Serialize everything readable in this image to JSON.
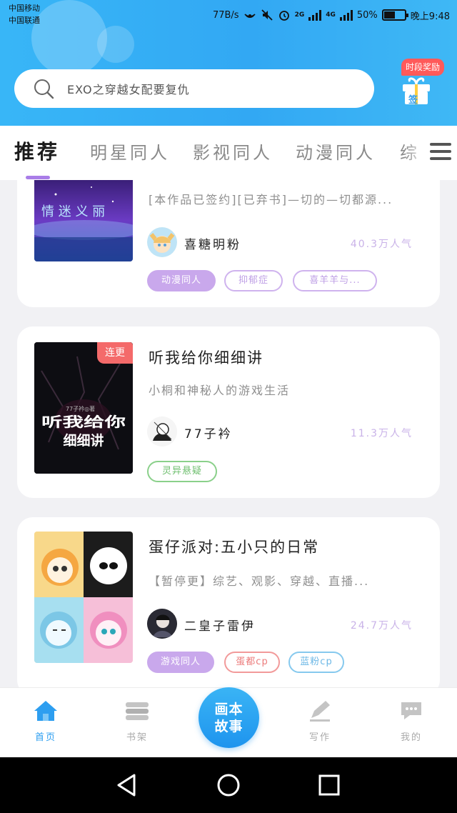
{
  "status_bar": {
    "carrier1": "中国移动",
    "carrier2": "中国联通",
    "speed": "77B/s",
    "network1": "2G",
    "network2": "4G",
    "battery": "50%",
    "battery_level": 0.5,
    "time": "晚上9:48"
  },
  "search": {
    "placeholder": "EXO之穿越女配要复仇",
    "icon": "search-icon"
  },
  "reward": {
    "tag": "时段奖励",
    "sign_label": "签",
    "icon": "gift-box-icon"
  },
  "tabs": [
    {
      "label": "推荐",
      "active": true
    },
    {
      "label": "明星同人",
      "active": false
    },
    {
      "label": "影视同人",
      "active": false
    },
    {
      "label": "动漫同人",
      "active": false
    },
    {
      "label": "综",
      "active": false
    }
  ],
  "cards": [
    {
      "cover_text": "情 迷 义 丽",
      "title": "",
      "desc": "[本作品已签约][已弃书]—切的—切都源...",
      "author": "喜糖明粉",
      "popularity": "40.3万人气",
      "tags": [
        {
          "label": "动漫同人",
          "style": "purple-fill"
        },
        {
          "label": "抑郁症",
          "style": "purple"
        },
        {
          "label": "喜羊羊与...",
          "style": "purple"
        }
      ]
    },
    {
      "update_tag": "连更",
      "cover_author": "77子衿◎著",
      "cover_title": "听我给你细细讲",
      "title": "听我给你细细讲",
      "desc": "小桐和神秘人的游戏生活",
      "author": "77子衿",
      "popularity": "11.3万人气",
      "tags": [
        {
          "label": "灵异悬疑",
          "style": "green"
        }
      ]
    },
    {
      "title": "蛋仔派对:五小只的日常",
      "desc": "【暂停更】综艺、观影、穿越、直播...",
      "author": "二皇子雷伊",
      "popularity": "24.7万人气",
      "tags": [
        {
          "label": "游戏同人",
          "style": "purple-fill"
        },
        {
          "label": "蛋都cp",
          "style": "red"
        },
        {
          "label": "蓝粉cp",
          "style": "blue"
        }
      ]
    }
  ],
  "bottom_nav": {
    "home": "首页",
    "bookshelf": "书架",
    "center_line1": "画本",
    "center_line2": "故事",
    "write": "写作",
    "mine": "我的"
  },
  "colors": {
    "header": "#35aef5",
    "accent_purple": "#a97de8",
    "nav_active": "#2d9ef0",
    "update_tag": "#f46a6a"
  }
}
